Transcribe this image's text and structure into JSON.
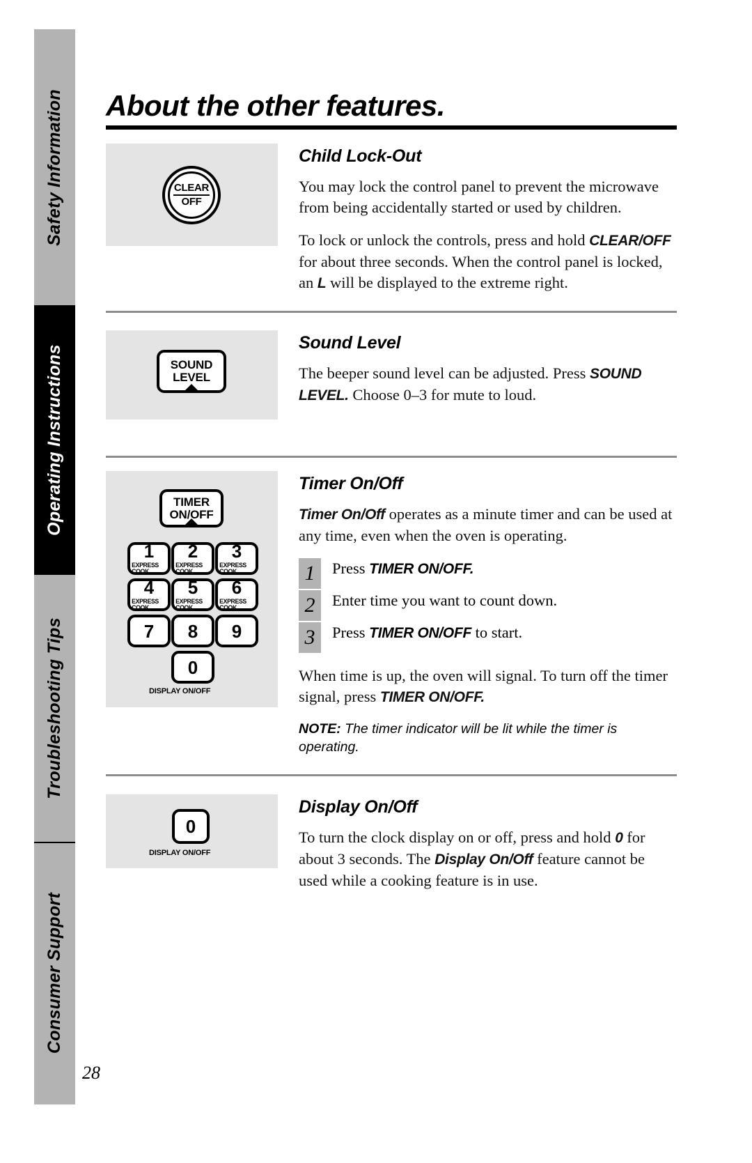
{
  "page": {
    "title": "About the other features.",
    "number": "28"
  },
  "sidebar": {
    "tabs": [
      {
        "label": "Safety Information"
      },
      {
        "label": "Operating Instructions"
      },
      {
        "label": "Troubleshooting Tips"
      },
      {
        "label": "Consumer Support"
      }
    ]
  },
  "sections": {
    "child_lock": {
      "heading": "Child Lock-Out",
      "para1": "You may lock the control panel to prevent the microwave from being accidentally started or used by children.",
      "para2_a": "To lock or unlock the controls, press and hold ",
      "para2_btn": "CLEAR/OFF",
      "para2_b": " for about three seconds. When the control panel is locked, an ",
      "para2_l": "L",
      "para2_c": " will be displayed to the extreme right.",
      "art": {
        "button_top": "CLEAR",
        "button_bottom": "OFF"
      }
    },
    "sound_level": {
      "heading": "Sound Level",
      "para1_a": "The beeper sound level can be adjusted. Press ",
      "para1_btn": "SOUND LEVEL.",
      "para1_b": " Choose 0–3 for mute to loud.",
      "art": {
        "button_line1": "SOUND",
        "button_line2": "LEVEL"
      }
    },
    "timer": {
      "heading": "Timer On/Off",
      "intro_btn": "Timer On/Off",
      "intro_text": " operates as a minute timer and can be used at any time, even when the oven is operating.",
      "steps": [
        {
          "num": "1",
          "text_a": "Press ",
          "text_btn": "TIMER ON/OFF.",
          "text_b": ""
        },
        {
          "num": "2",
          "text_a": "Enter time you want to count down.",
          "text_btn": "",
          "text_b": ""
        },
        {
          "num": "3",
          "text_a": "Press ",
          "text_btn": "TIMER ON/OFF",
          "text_b": " to start."
        }
      ],
      "after_a": "When time is up, the oven will signal. To turn off the timer signal, press ",
      "after_btn": "TIMER ON/OFF.",
      "note_label": "NOTE:",
      "note_text": " The timer indicator will be lit while the timer is operating.",
      "art": {
        "timer_line1": "TIMER",
        "timer_line2": "ON/OFF",
        "keys": [
          {
            "num": "1",
            "sub": "EXPRESS COOK"
          },
          {
            "num": "2",
            "sub": "EXPRESS COOK"
          },
          {
            "num": "3",
            "sub": "EXPRESS COOK"
          },
          {
            "num": "4",
            "sub": "EXPRESS COOK"
          },
          {
            "num": "5",
            "sub": "EXPRESS COOK"
          },
          {
            "num": "6",
            "sub": "EXPRESS COOK"
          },
          {
            "num": "7",
            "sub": ""
          },
          {
            "num": "8",
            "sub": ""
          },
          {
            "num": "9",
            "sub": ""
          }
        ],
        "zero_key": "0",
        "zero_caption": "DISPLAY ON/OFF"
      }
    },
    "display": {
      "heading": "Display On/Off",
      "para1_a": "To turn the clock display on or off, press and hold ",
      "para1_btn": "0",
      "para1_b": " for about 3 seconds. The ",
      "para1_btn2": "Display On/Off",
      "para1_c": " feature cannot be used while a cooking feature is in use.",
      "art": {
        "zero_key": "0",
        "zero_caption": "DISPLAY ON/OFF"
      }
    }
  }
}
